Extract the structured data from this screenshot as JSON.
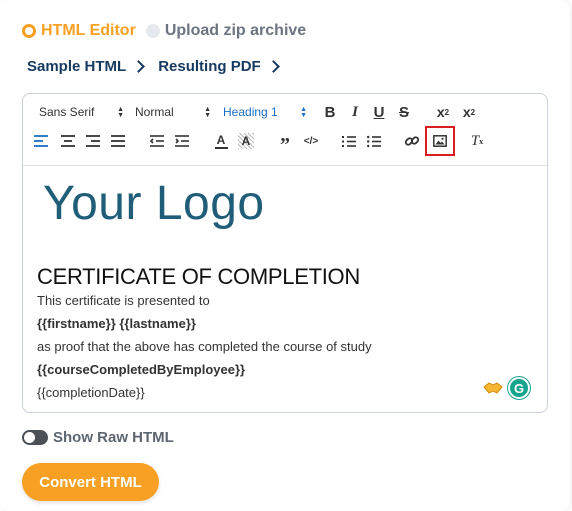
{
  "modes": {
    "html_editor": "HTML Editor",
    "upload_zip": "Upload zip archive"
  },
  "breadcrumb": {
    "sample_html": "Sample HTML",
    "resulting_pdf": "Resulting PDF"
  },
  "toolbar": {
    "font_family": "Sans Serif",
    "font_size": "Normal",
    "heading": "Heading 1",
    "bold": "B",
    "italic": "I",
    "underline": "U",
    "strike": "S",
    "superscript": "x",
    "superscript_mark": "2",
    "subscript": "x",
    "subscript_mark": "2",
    "text_color": "A",
    "background_color": "A",
    "blockquote": "”",
    "code": "</>",
    "clear_format": "T",
    "clear_format_mark": "x",
    "highlighted_tool": "image-icon"
  },
  "content": {
    "logo": "Your Logo",
    "title": "CERTIFICATE OF COMPLETION",
    "line1": "This certificate is presented to",
    "line2": "{{firstname}} {{lastname}}",
    "line3": "as proof that the above has completed the course of study",
    "line4": "{{courseCompletedByEmployee}}",
    "line5": "{{completionDate}}"
  },
  "grammarly_badge": "G",
  "raw_html_toggle": {
    "label": "Show Raw HTML",
    "on": false
  },
  "convert_button": "Convert HTML",
  "colors": {
    "accent": "#f7a024",
    "navy": "#163a5f",
    "logo": "#1f5d78",
    "heading_blue": "#1a6fc4",
    "highlight_box": "#d81e1e",
    "grammarly": "#15a58e"
  }
}
